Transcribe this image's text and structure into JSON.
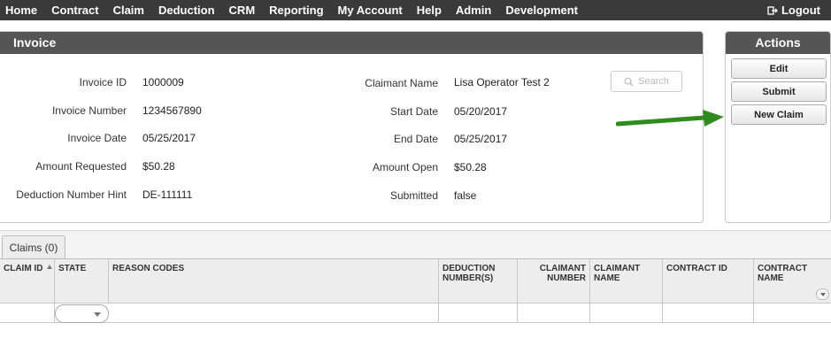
{
  "nav": {
    "items": [
      "Home",
      "Contract",
      "Claim",
      "Deduction",
      "CRM",
      "Reporting",
      "My Account",
      "Help",
      "Admin",
      "Development"
    ],
    "logout": "Logout"
  },
  "invoice": {
    "title": "Invoice",
    "invoice_id_label": "Invoice ID",
    "invoice_id": "1000009",
    "invoice_number_label": "Invoice Number",
    "invoice_number": "1234567890",
    "invoice_date_label": "Invoice Date",
    "invoice_date": "05/25/2017",
    "amount_requested_label": "Amount Requested",
    "amount_requested": "$50.28",
    "deduction_hint_label": "Deduction Number Hint",
    "deduction_hint": "DE-111111",
    "claimant_name_label": "Claimant Name",
    "claimant_name": "Lisa Operator Test 2",
    "start_date_label": "Start Date",
    "start_date": "05/20/2017",
    "end_date_label": "End Date",
    "end_date": "05/25/2017",
    "amount_open_label": "Amount Open",
    "amount_open": "$50.28",
    "submitted_label": "Submitted",
    "submitted": "false",
    "search_label": "Search"
  },
  "actions": {
    "title": "Actions",
    "edit": "Edit",
    "submit": "Submit",
    "new_claim": "New Claim"
  },
  "annotation": {
    "arrow_color": "#2e8b1e"
  },
  "claims": {
    "tab_label": "Claims (0)",
    "columns": {
      "claim_id": "CLAIM ID",
      "state": "STATE",
      "reason_codes": "REASON CODES",
      "deduction_numbers": "DEDUCTION NUMBER(S)",
      "claimant_number": "CLAIMANT NUMBER",
      "claimant_name": "CLAIMANT NAME",
      "contract_id": "CONTRACT ID",
      "contract_name": "CONTRACT NAME"
    }
  }
}
